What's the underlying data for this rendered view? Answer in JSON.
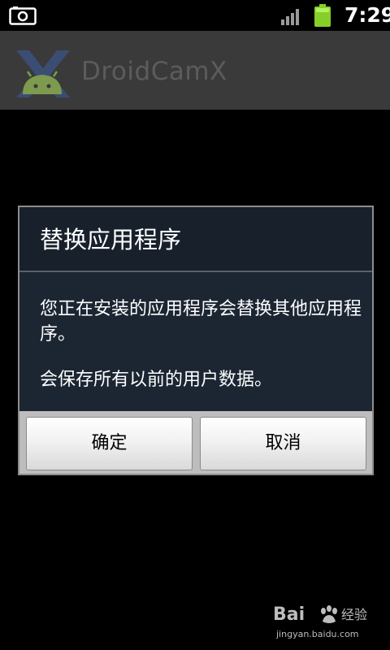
{
  "status_bar": {
    "time": "7:29",
    "icons": [
      "camera-icon",
      "signal-icon",
      "battery-icon"
    ],
    "battery_color": "#86cf2a"
  },
  "app_bar": {
    "app_name": "DroidCamX",
    "logo_icon": "droidcamx-logo-icon"
  },
  "dialog": {
    "title": "替换应用程序",
    "message_1": "您正在安装的应用程序会替换其他应用程序。",
    "message_2": "会保存所有以前的用户数据。",
    "ok_label": "确定",
    "cancel_label": "取消"
  },
  "watermark": {
    "brand": "Bai",
    "suffix": "经验",
    "url": "jingyan.baidu.com",
    "icon": "baidu-paw-icon"
  },
  "colors": {
    "dialog_bg": "#1c2633",
    "title_bar_bg": "#3a3a3a",
    "button_bar_bg": "#bdbdbd"
  }
}
